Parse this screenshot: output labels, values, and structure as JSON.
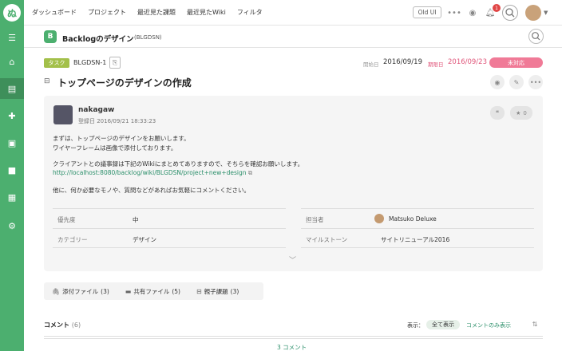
{
  "topbar": {
    "logo_text": "ぬ",
    "nav": [
      "ダッシュボード",
      "プロジェクト",
      "最近見た課題",
      "最近見たWiki",
      "フィルタ"
    ],
    "old_ui_label": "Old UI",
    "notifications_count": "1"
  },
  "project": {
    "icon_text": "B",
    "name": "Backlogのデザイン",
    "key": "(BLGDSN)"
  },
  "issue": {
    "type_tag": "タスク",
    "key": "BLGDSN-1",
    "start_label": "開始日",
    "start_date": "2016/09/19",
    "due_label": "期限日",
    "due_date": "2016/09/23",
    "status": "未対応",
    "title": "トップページのデザインの作成"
  },
  "card": {
    "user_name": "nakagaw",
    "registered": "登録日 2016/09/21 18:33:23",
    "star_count": "0",
    "desc_lines": [
      "まずは、トップページのデザインをお願いします。",
      "ワイヤーフレームは画像で添付しております。",
      "クライアントとの議事録は下記のWikiにまとめてありますので、そちらを確認お願いします。",
      "http://localhost:8080/backlog/wiki/BLGDSN/project+new+design",
      "他に、何か必要なモノや、質問などがあればお気軽にコメントください。"
    ],
    "attrs": {
      "priority_label": "優先度",
      "priority_value": "中",
      "category_label": "カテゴリー",
      "category_value": "デザイン",
      "assignee_label": "担当者",
      "assignee_value": "Matsuko Deluxe",
      "milestone_label": "マイルストーン",
      "milestone_value": "サイトリニューアル2016"
    }
  },
  "tabs": [
    {
      "label": "添付ファイル",
      "count": "(3)"
    },
    {
      "label": "共有ファイル",
      "count": "(5)"
    },
    {
      "label": "親子課題",
      "count": "(3)"
    }
  ],
  "comments": {
    "title": "コメント",
    "count": "(6)",
    "display_label": "表示：",
    "show_all": "全て表示",
    "show_comments_only": "コメントのみ表示",
    "more": "3 コメント"
  }
}
